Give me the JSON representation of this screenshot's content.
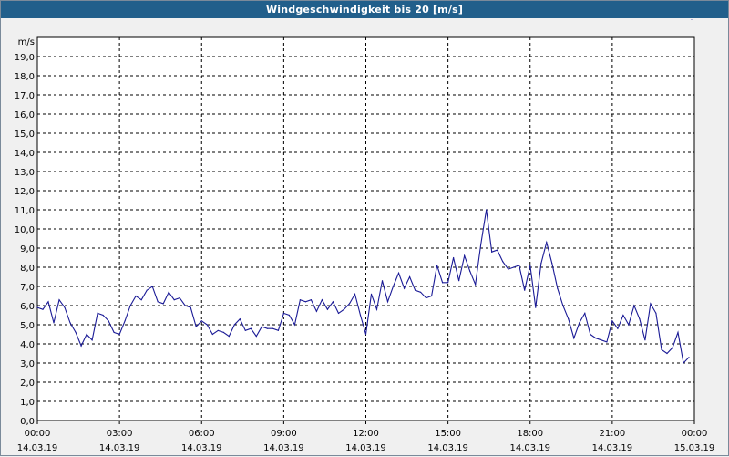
{
  "window": {
    "title": "Windgeschwindigkeit bis 20 [m/s]"
  },
  "colors": {
    "titlebar": "#215f8b",
    "series": "#1a1a96",
    "grid": "#000000",
    "plot_bg": "#ffffff"
  },
  "chart_data": {
    "type": "line",
    "title": "Windgeschwindigkeit bis 20 [m/s]",
    "ylabel": "m/s",
    "xlabel": "",
    "ylim": [
      0,
      20
    ],
    "y_ticks": [
      "0,0",
      "1,0",
      "2,0",
      "3,0",
      "4,0",
      "5,0",
      "6,0",
      "7,0",
      "8,0",
      "9,0",
      "10,0",
      "11,0",
      "12,0",
      "13,0",
      "14,0",
      "15,0",
      "16,0",
      "17,0",
      "18,0",
      "19,0"
    ],
    "x_range_hours": [
      0,
      24
    ],
    "x_ticks": [
      {
        "time": "00:00",
        "date": "14.03.19"
      },
      {
        "time": "03:00",
        "date": "14.03.19"
      },
      {
        "time": "06:00",
        "date": "14.03.19"
      },
      {
        "time": "09:00",
        "date": "14.03.19"
      },
      {
        "time": "12:00",
        "date": "14.03.19"
      },
      {
        "time": "15:00",
        "date": "14.03.19"
      },
      {
        "time": "18:00",
        "date": "14.03.19"
      },
      {
        "time": "21:00",
        "date": "14.03.19"
      },
      {
        "time": "00:00",
        "date": "15.03.19"
      }
    ],
    "grid": true,
    "legend": "none",
    "series": [
      {
        "x_hours": [
          0,
          0.2,
          0.4,
          0.6,
          0.8,
          1.0,
          1.2,
          1.4,
          1.6,
          1.8,
          2.0,
          2.2,
          2.4,
          2.6,
          2.8,
          3.0,
          3.2,
          3.4,
          3.6,
          3.8,
          4.0,
          4.2,
          4.4,
          4.6,
          4.8,
          5.0,
          5.2,
          5.4,
          5.6,
          5.8,
          6.0,
          6.2,
          6.4,
          6.6,
          6.8,
          7.0,
          7.2,
          7.4,
          7.6,
          7.8,
          8.0,
          8.2,
          8.4,
          8.6,
          8.8,
          9.0,
          9.2,
          9.4,
          9.6,
          9.8,
          10.0,
          10.2,
          10.4,
          10.6,
          10.8,
          11.0,
          11.2,
          11.4,
          11.6,
          11.8,
          12.0,
          12.2,
          12.4,
          12.6,
          12.8,
          13.0,
          13.2,
          13.4,
          13.6,
          13.8,
          14.0,
          14.2,
          14.4,
          14.6,
          14.8,
          15.0,
          15.2,
          15.4,
          15.6,
          15.8,
          16.0,
          16.2,
          16.4,
          16.6,
          16.8,
          17.0,
          17.2,
          17.4,
          17.6,
          17.8,
          18.0,
          18.2,
          18.4,
          18.6,
          18.8,
          19.0,
          19.2,
          19.4,
          19.6,
          19.8,
          20.0,
          20.2,
          20.4,
          20.6,
          20.8,
          21.0,
          21.2,
          21.4,
          21.6,
          21.8,
          22.0,
          22.2,
          22.4,
          22.6,
          22.8,
          23.0,
          23.2,
          23.4,
          23.6,
          23.8,
          23.9
        ],
        "values": [
          5.9,
          5.8,
          6.2,
          5.1,
          6.3,
          5.9,
          5.1,
          4.6,
          3.9,
          4.5,
          4.2,
          5.6,
          5.5,
          5.2,
          4.6,
          4.5,
          5.2,
          6.0,
          6.5,
          6.3,
          6.8,
          7.0,
          6.2,
          6.1,
          6.7,
          6.3,
          6.4,
          6.0,
          5.9,
          4.9,
          5.2,
          5.0,
          4.5,
          4.7,
          4.6,
          4.4,
          5.0,
          5.3,
          4.7,
          4.8,
          4.4,
          4.9,
          4.8,
          4.8,
          4.7,
          5.6,
          5.5,
          5.0,
          6.3,
          6.2,
          6.3,
          5.7,
          6.3,
          5.8,
          6.2,
          5.6,
          5.8,
          6.1,
          6.6,
          5.5,
          4.5,
          6.6,
          5.8,
          7.3,
          6.2,
          7.0,
          7.7,
          6.9,
          7.5,
          6.8,
          6.7,
          6.4,
          6.5,
          8.1,
          7.2,
          7.2,
          8.5,
          7.3,
          8.6,
          7.8,
          7.1,
          9.2,
          11.0,
          8.8,
          8.9,
          8.3,
          7.9,
          8.0,
          8.1,
          6.8,
          8.1,
          5.9,
          8.2,
          9.3,
          8.2,
          6.9,
          6.0,
          5.3,
          4.3,
          5.1,
          5.6,
          4.5,
          4.3,
          4.2,
          4.1,
          5.2,
          4.8,
          5.5,
          5.0,
          6.0,
          5.3,
          4.2,
          6.1,
          5.6,
          3.7,
          3.5,
          3.8,
          4.6,
          3.0,
          3.3
        ]
      }
    ]
  }
}
